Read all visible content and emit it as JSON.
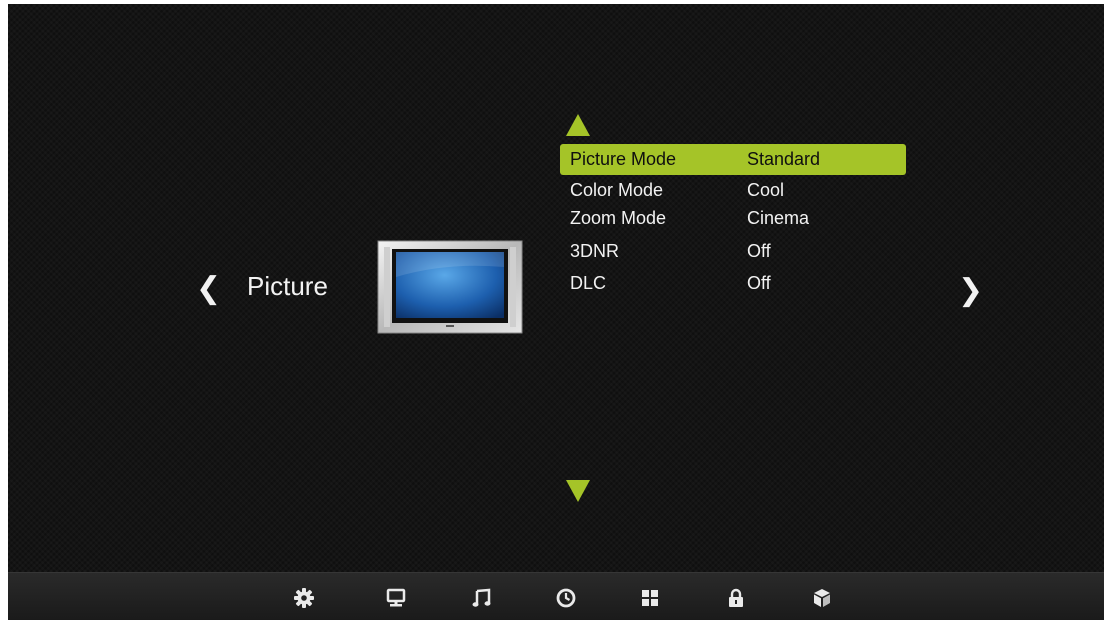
{
  "category": {
    "label": "Picture",
    "prev_arrow": "❮",
    "next_arrow": "❯"
  },
  "menu": {
    "items": [
      {
        "label": "Picture Mode",
        "value": "Standard",
        "selected": true
      },
      {
        "label": "Color Mode",
        "value": "Cool",
        "selected": false
      },
      {
        "label": "Zoom Mode",
        "value": "Cinema",
        "selected": false
      },
      {
        "label": "3DNR",
        "value": "Off",
        "selected": false
      },
      {
        "label": "DLC",
        "value": "Off",
        "selected": false
      }
    ]
  },
  "taskbar": {
    "icons": [
      "gear-icon",
      "monitor-icon",
      "music-note-icon",
      "clock-icon",
      "grid-icon",
      "lock-icon",
      "cube-icon"
    ]
  },
  "colors": {
    "accent": "#a5c428",
    "background": "#141414",
    "text": "#f2f2f2"
  }
}
